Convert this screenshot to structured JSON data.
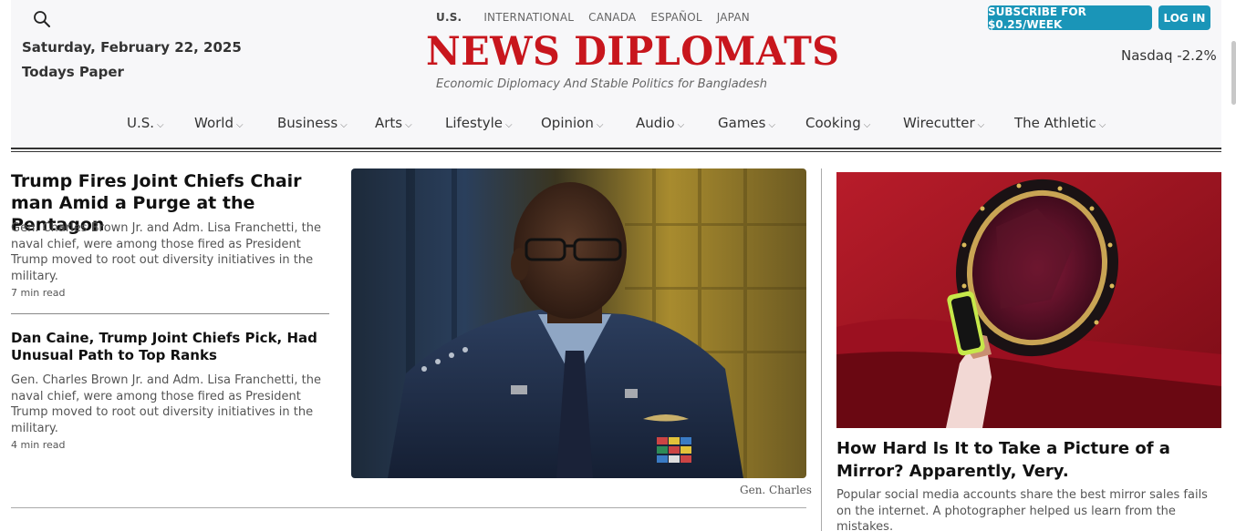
{
  "header": {
    "date": "Saturday, February 22, 2025",
    "todays_paper": "Todays Paper",
    "editions": [
      "U.S.",
      "INTERNATIONAL",
      "CANADA",
      "ESPAÑOL",
      "JAPAN"
    ],
    "logo": "NEWS DIPLOMATS",
    "tagline": "Economic Diplomacy And Stable Politics for Bangladesh",
    "subscribe_label": "SUBSCRIBE FOR $0.25/WEEK",
    "login_label": "LOG IN",
    "ticker": "Nasdaq -2.2%",
    "accent_color": "#1a95b8",
    "logo_color": "#c8161d"
  },
  "nav": {
    "items": [
      "U.S.",
      "World",
      "Business",
      "Arts",
      "Lifestyle",
      "Opinion",
      "Audio",
      "Games",
      "Cooking",
      "Wirecutter",
      "The Athletic"
    ]
  },
  "main": {
    "stories": [
      {
        "title": "Trump Fires Joint Chiefs Chair man Amid a Purge at the Pentagon",
        "summary": "Gen. Charles Brown Jr. and Adm. Lisa Franchetti, the naval chief, were among those fired as President Trump moved to root out diversity initiatives in the military.",
        "read_time": "7 min read"
      },
      {
        "title": "Dan Caine, Trump Joint Chiefs Pick, Had Unusual Path to Top Ranks",
        "summary": "Gen. Charles Brown Jr. and Adm. Lisa Franchetti, the naval chief, were among those fired as President Trump moved to root out diversity initiatives in the military.",
        "read_time": "4 min read"
      }
    ],
    "hero_caption": "Gen. Charles"
  },
  "side": {
    "title": "How Hard Is It to Take a Picture of a Mirror? Apparently, Very.",
    "summary": "Popular social media accounts share the best mirror sales fails on the internet. A photographer helped us learn from the mistakes."
  }
}
